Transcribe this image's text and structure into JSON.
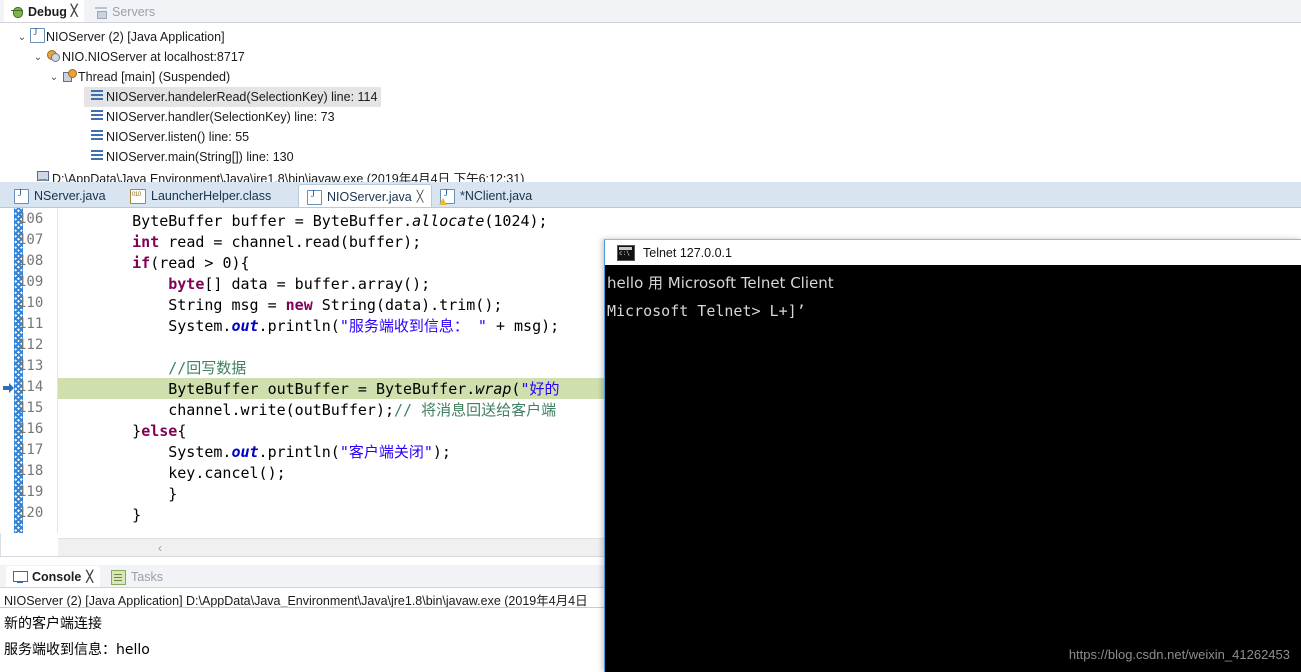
{
  "debug_view": {
    "tabs": [
      {
        "label": "Debug",
        "icon": "bug-icon",
        "active": true,
        "closable": true
      },
      {
        "label": "Servers",
        "icon": "servers-icon",
        "active": false,
        "closable": false
      }
    ],
    "tree": [
      {
        "indent": 0,
        "chevron": "⌄",
        "icon": "java-application-icon",
        "label": "NIOServer (2) [Java Application]",
        "selected": false
      },
      {
        "indent": 1,
        "chevron": "⌄",
        "icon": "debug-target-icon",
        "label": "NIO.NIOServer at localhost:8717",
        "selected": false
      },
      {
        "indent": 2,
        "chevron": "⌄",
        "icon": "thread-icon",
        "label": "Thread [main] (Suspended)",
        "selected": false
      },
      {
        "indent": 3,
        "chevron": "",
        "icon": "stack-frame-icon",
        "label": "NIOServer.handelerRead(SelectionKey) line: 114",
        "selected": true
      },
      {
        "indent": 3,
        "chevron": "",
        "icon": "stack-frame-icon",
        "label": "NIOServer.handler(SelectionKey) line: 73",
        "selected": false
      },
      {
        "indent": 3,
        "chevron": "",
        "icon": "stack-frame-icon",
        "label": "NIOServer.listen() line: 55",
        "selected": false
      },
      {
        "indent": 3,
        "chevron": "",
        "icon": "stack-frame-icon",
        "label": "NIOServer.main(String[]) line: 130",
        "selected": false
      },
      {
        "indent": 1,
        "chevron": "",
        "icon": "process-icon",
        "label": "D:\\AppData\\Java Environment\\Java\\jre1.8\\bin\\javaw.exe (2019年4月4日 下午6:12:31)",
        "selected": false
      }
    ]
  },
  "editor": {
    "tabs": [
      {
        "label": "NServer.java",
        "icon": "java-file-icon",
        "active": false,
        "closable": false,
        "dirty": false
      },
      {
        "label": "LauncherHelper.class",
        "icon": "class-file-icon",
        "active": false,
        "closable": false,
        "dirty": false
      },
      {
        "label": "NIOServer.java",
        "icon": "java-file-icon",
        "active": true,
        "closable": true,
        "dirty": false
      },
      {
        "label": "*NClient.java",
        "icon": "java-file-warning-icon",
        "active": false,
        "closable": false,
        "dirty": true
      }
    ],
    "current_line": 114,
    "highlight_color": "#cfdfae",
    "first_line": 106,
    "lines": [
      {
        "no": 106,
        "indent": 8,
        "tokens": [
          {
            "t": "ByteBuffer buffer = ByteBuffer.",
            "c": "plain"
          },
          {
            "t": "allocate",
            "c": "smeth"
          },
          {
            "t": "(1024);",
            "c": "plain"
          }
        ]
      },
      {
        "no": 107,
        "indent": 8,
        "tokens": [
          {
            "t": "int",
            "c": "kw"
          },
          {
            "t": " read = channel.read(buffer);",
            "c": "plain"
          }
        ]
      },
      {
        "no": 108,
        "indent": 8,
        "tokens": [
          {
            "t": "if",
            "c": "kw"
          },
          {
            "t": "(read > 0){",
            "c": "plain"
          }
        ]
      },
      {
        "no": 109,
        "indent": 12,
        "tokens": [
          {
            "t": "byte",
            "c": "kw"
          },
          {
            "t": "[] data = buffer.array();",
            "c": "plain"
          }
        ]
      },
      {
        "no": 110,
        "indent": 12,
        "tokens": [
          {
            "t": "String msg = ",
            "c": "plain"
          },
          {
            "t": "new",
            "c": "kw"
          },
          {
            "t": " String(data).trim();",
            "c": "plain"
          }
        ]
      },
      {
        "no": 111,
        "indent": 12,
        "tokens": [
          {
            "t": "System.",
            "c": "plain"
          },
          {
            "t": "out",
            "c": "sfld"
          },
          {
            "t": ".println(",
            "c": "plain"
          },
          {
            "t": "\"服务端收到信息： \"",
            "c": "str"
          },
          {
            "t": " + msg);",
            "c": "plain"
          }
        ]
      },
      {
        "no": 112,
        "indent": 0,
        "tokens": []
      },
      {
        "no": 113,
        "indent": 12,
        "tokens": [
          {
            "t": "//回写数据",
            "c": "cmt"
          }
        ]
      },
      {
        "no": 114,
        "indent": 12,
        "tokens": [
          {
            "t": "ByteBuffer outBuffer = ByteBuffer.",
            "c": "plain"
          },
          {
            "t": "wrap",
            "c": "smeth"
          },
          {
            "t": "(",
            "c": "plain"
          },
          {
            "t": "\"好的",
            "c": "str"
          }
        ]
      },
      {
        "no": 115,
        "indent": 12,
        "tokens": [
          {
            "t": "channel.write(outBuffer);",
            "c": "plain"
          },
          {
            "t": "// 将消息回送给客户端",
            "c": "cmt"
          }
        ]
      },
      {
        "no": 116,
        "indent": 8,
        "tokens": [
          {
            "t": "}",
            "c": "plain"
          },
          {
            "t": "else",
            "c": "kw"
          },
          {
            "t": "{",
            "c": "plain"
          }
        ]
      },
      {
        "no": 117,
        "indent": 12,
        "tokens": [
          {
            "t": "System.",
            "c": "plain"
          },
          {
            "t": "out",
            "c": "sfld"
          },
          {
            "t": ".println(",
            "c": "plain"
          },
          {
            "t": "\"客户端关闭\"",
            "c": "str"
          },
          {
            "t": ");",
            "c": "plain"
          }
        ]
      },
      {
        "no": 118,
        "indent": 12,
        "tokens": [
          {
            "t": "key.cancel();",
            "c": "plain"
          }
        ]
      },
      {
        "no": 119,
        "indent": 12,
        "tokens": [
          {
            "t": "}",
            "c": "plain"
          }
        ]
      },
      {
        "no": 120,
        "indent": 8,
        "tokens": [
          {
            "t": "}",
            "c": "plain"
          }
        ]
      }
    ],
    "hscroll_arrow": "‹"
  },
  "console_view": {
    "tabs": [
      {
        "label": "Console",
        "icon": "console-icon",
        "active": true,
        "closable": true
      },
      {
        "label": "Tasks",
        "icon": "tasks-icon",
        "active": false,
        "closable": false
      }
    ],
    "header": "NIOServer (2) [Java Application] D:\\AppData\\Java_Environment\\Java\\jre1.8\\bin\\javaw.exe (2019年4月4日",
    "output": [
      "新的客户端连接",
      "服务端收到信息：hello"
    ]
  },
  "telnet_window": {
    "title": "Telnet 127.0.0.1",
    "icon": "console-app-icon",
    "lines": [
      "hello 用 Microsoft Telnet Client",
      "",
      "Microsoft Telnet> L+]’"
    ],
    "background": "#000000",
    "foreground": "#d7d7d7"
  },
  "watermark": {
    "text": "https://blog.csdn.net/weixin_41262453"
  }
}
